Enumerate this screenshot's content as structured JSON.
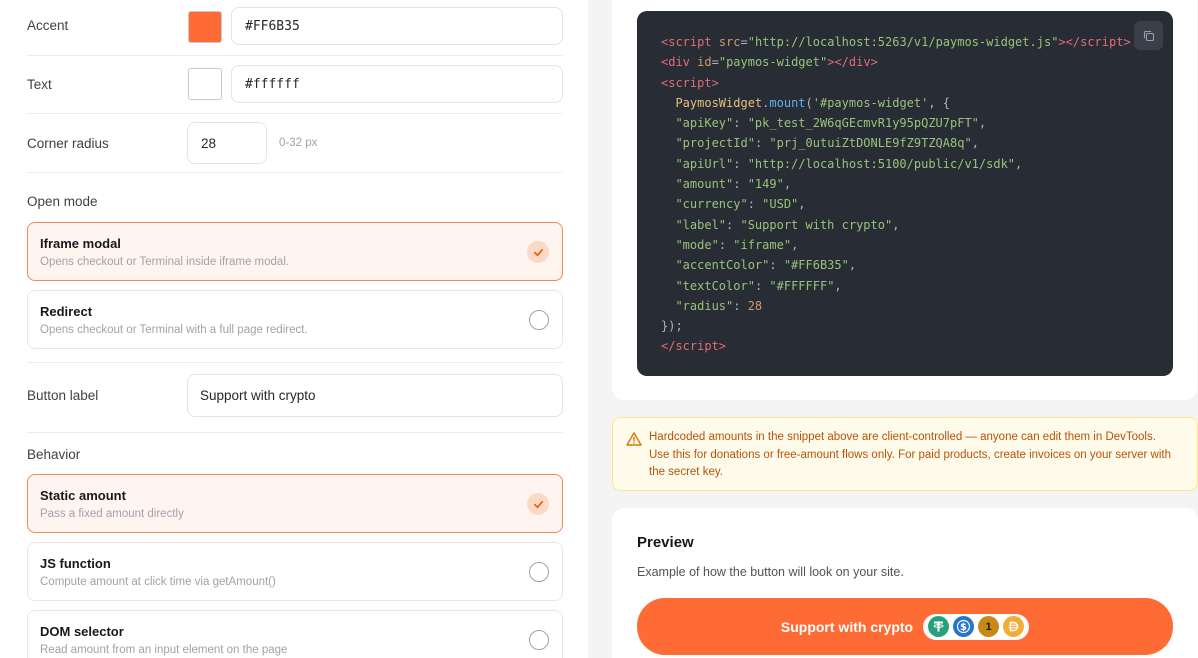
{
  "settings": {
    "accent": {
      "label": "Accent",
      "value": "#FF6B35",
      "swatch": "#FF6B35"
    },
    "text": {
      "label": "Text",
      "value": "#ffffff",
      "swatch": "#ffffff"
    },
    "radius": {
      "label": "Corner radius",
      "value": "28",
      "hint": "0-32 px"
    },
    "open_mode": {
      "title": "Open mode",
      "options": [
        {
          "title": "Iframe modal",
          "desc": "Opens checkout or Terminal inside iframe modal.",
          "selected": true
        },
        {
          "title": "Redirect",
          "desc": "Opens checkout or Terminal with a full page redirect.",
          "selected": false
        }
      ]
    },
    "button_label": {
      "label": "Button label",
      "value": "Support with crypto"
    },
    "behavior": {
      "title": "Behavior",
      "options": [
        {
          "title": "Static amount",
          "desc": "Pass a fixed amount directly",
          "selected": true
        },
        {
          "title": "JS function",
          "desc": "Compute amount at click time via getAmount()",
          "selected": false
        },
        {
          "title": "DOM selector",
          "desc": "Read amount from an input element on the page",
          "selected": false
        }
      ]
    }
  },
  "snippet": {
    "script_src": "http://localhost:5263/v1/paymos-widget.js",
    "div_id": "paymos-widget",
    "object": "PaymosWidget",
    "method": "mount",
    "selector": "'#paymos-widget'",
    "props": [
      {
        "key": "\"apiKey\"",
        "value": "\"pk_test_2W6qGEcmvR1y95pQZU7pFT\"",
        "type": "str"
      },
      {
        "key": "\"projectId\"",
        "value": "\"prj_0utuiZtDONLE9fZ9TZQA8q\"",
        "type": "str"
      },
      {
        "key": "\"apiUrl\"",
        "value": "\"http://localhost:5100/public/v1/sdk\"",
        "type": "str"
      },
      {
        "key": "\"amount\"",
        "value": "\"149\"",
        "type": "str"
      },
      {
        "key": "\"currency\"",
        "value": "\"USD\"",
        "type": "str"
      },
      {
        "key": "\"label\"",
        "value": "\"Support with crypto\"",
        "type": "str"
      },
      {
        "key": "\"mode\"",
        "value": "\"iframe\"",
        "type": "str"
      },
      {
        "key": "\"accentColor\"",
        "value": "\"#FF6B35\"",
        "type": "str"
      },
      {
        "key": "\"textColor\"",
        "value": "\"#FFFFFF\"",
        "type": "str"
      },
      {
        "key": "\"radius\"",
        "value": "28",
        "type": "num"
      }
    ]
  },
  "warning": {
    "text": "Hardcoded amounts in the snippet above are client-controlled — anyone can edit them in DevTools. Use this for donations or free-amount flows only. For paid products, create invoices on your server with the secret key."
  },
  "preview": {
    "title": "Preview",
    "desc": "Example of how the button will look on your site.",
    "button_label": "Support with crypto",
    "coins": [
      {
        "icon": "tether-icon",
        "color": "#26a17b"
      },
      {
        "icon": "usdc-icon",
        "color": "#2775ca"
      },
      {
        "icon": "one-inch-icon",
        "color": "#c58a18"
      },
      {
        "icon": "dai-icon",
        "color": "#f5ac37"
      }
    ]
  },
  "colors": {
    "accent": "#FF6B35",
    "code_bg": "#282c34"
  }
}
